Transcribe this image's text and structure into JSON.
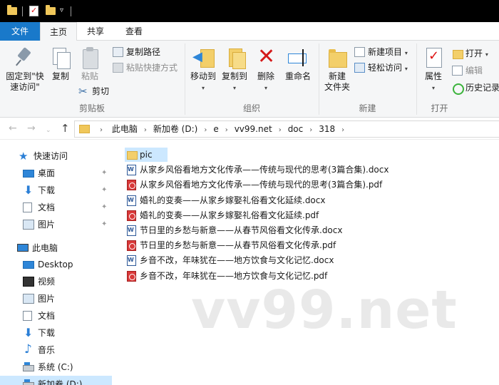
{
  "ribbon_tabs": {
    "file": "文件",
    "home": "主页",
    "share": "共享",
    "view": "查看"
  },
  "clipboard": {
    "pin_label_line1": "固定到\"快",
    "pin_label_line2": "速访问\"",
    "copy": "复制",
    "paste": "粘贴",
    "copy_path": "复制路径",
    "paste_shortcut": "粘贴快捷方式",
    "cut": "剪切",
    "group": "剪贴板"
  },
  "organize": {
    "move_to": "移动到",
    "copy_to": "复制到",
    "delete": "删除",
    "rename": "重命名",
    "group": "组织"
  },
  "new_group": {
    "new_folder_line1": "新建",
    "new_folder_line2": "文件夹",
    "new_item": "新建项目",
    "easy_access": "轻松访问",
    "group": "新建"
  },
  "open_group": {
    "properties": "属性",
    "open": "打开",
    "edit": "编辑",
    "history": "历史记录",
    "group": "打开"
  },
  "breadcrumb": [
    "此电脑",
    "新加卷 (D:)",
    "e",
    "vv99.net",
    "doc",
    "318"
  ],
  "nav_pane": {
    "quick_access": "快速访问",
    "quick_items": [
      {
        "label": "桌面",
        "icon": "desktop-icon"
      },
      {
        "label": "下载",
        "icon": "download-icon"
      },
      {
        "label": "文档",
        "icon": "documents-icon"
      },
      {
        "label": "图片",
        "icon": "pictures-icon"
      }
    ],
    "this_pc": "此电脑",
    "pc_items": [
      {
        "label": "Desktop",
        "icon": "desktop-icon"
      },
      {
        "label": "视频",
        "icon": "videos-icon"
      },
      {
        "label": "图片",
        "icon": "pictures-icon"
      },
      {
        "label": "文档",
        "icon": "documents-icon"
      },
      {
        "label": "下载",
        "icon": "download-icon"
      },
      {
        "label": "音乐",
        "icon": "music-icon"
      },
      {
        "label": "系统 (C:)",
        "icon": "drive-icon"
      },
      {
        "label": "新加卷 (D:)",
        "icon": "drive-icon"
      }
    ]
  },
  "files": [
    {
      "name": "pic",
      "type": "folder"
    },
    {
      "name": "从家乡风俗看地方文化传承——传统与现代的思考(3篇合集).docx",
      "type": "docx"
    },
    {
      "name": "从家乡风俗看地方文化传承——传统与现代的思考(3篇合集).pdf",
      "type": "pdf"
    },
    {
      "name": "婚礼的变奏——从家乡嫁娶礼俗看文化延续.docx",
      "type": "docx"
    },
    {
      "name": "婚礼的变奏——从家乡嫁娶礼俗看文化延续.pdf",
      "type": "pdf"
    },
    {
      "name": "节日里的乡愁与新意——从春节风俗看文化传承.docx",
      "type": "docx"
    },
    {
      "name": "节日里的乡愁与新意——从春节风俗看文化传承.pdf",
      "type": "pdf"
    },
    {
      "name": "乡音不改，年味犹在——地方饮食与文化记忆.docx",
      "type": "docx"
    },
    {
      "name": "乡音不改，年味犹在——地方饮食与文化记忆.pdf",
      "type": "pdf"
    }
  ],
  "watermark": "vv99.net",
  "colors": {
    "file_tab": "#1979ca",
    "selection": "#cce8ff",
    "ribbon_bg": "#f5f6f7"
  }
}
